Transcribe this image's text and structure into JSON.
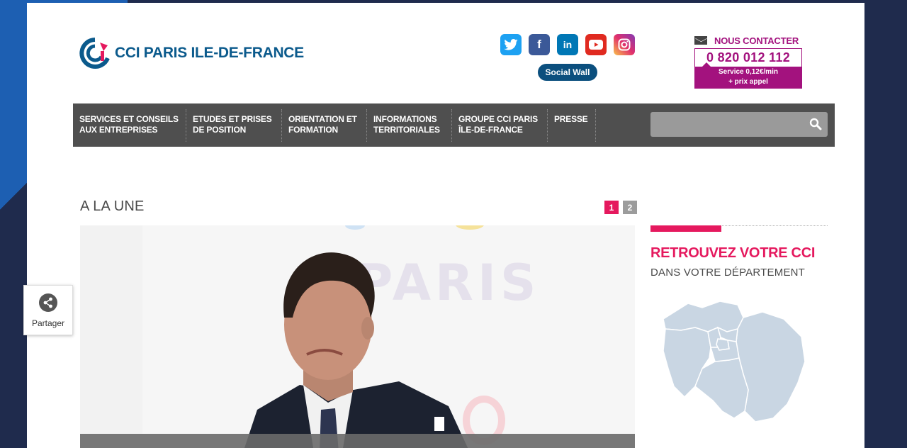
{
  "header": {
    "logo_text": "CCI PARIS ILE-DE-FRANCE",
    "socials": [
      "twitter-icon",
      "facebook-icon",
      "linkedin-icon",
      "youtube-icon",
      "instagram-icon"
    ],
    "social_wall_label": "Social Wall",
    "contact": {
      "label": "NOUS CONTACTER",
      "phone": "0 820 012 112",
      "note_line1": "Service 0,12€/min",
      "note_line2": "+ prix appel"
    }
  },
  "nav": {
    "items": [
      {
        "line1": "SERVICES ET CONSEILS",
        "line2": "AUX ENTREPRISES"
      },
      {
        "line1": "ETUDES ET PRISES",
        "line2": "DE POSITION"
      },
      {
        "line1": "ORIENTATION ET",
        "line2": "FORMATION"
      },
      {
        "line1": "INFORMATIONS",
        "line2": "TERRITORIALES"
      },
      {
        "line1": "GROUPE CCI PARIS",
        "line2": "ÎLE-DE-FRANCE"
      },
      {
        "line1": "PRESSE",
        "line2": ""
      }
    ],
    "search_placeholder": ""
  },
  "main": {
    "section_title": "A LA UNE",
    "pager": [
      "1",
      "2"
    ],
    "hero_bg_text": "PARIS"
  },
  "side": {
    "title": "RETROUVEZ VOTRE CCI",
    "subtitle": "DANS VOTRE DÉPARTEMENT"
  },
  "share": {
    "label": "Partager"
  },
  "colors": {
    "brand_blue": "#0b5a8c",
    "magenta": "#a3127e",
    "pink": "#e5195e",
    "nav_bg": "#4f4f4f"
  }
}
